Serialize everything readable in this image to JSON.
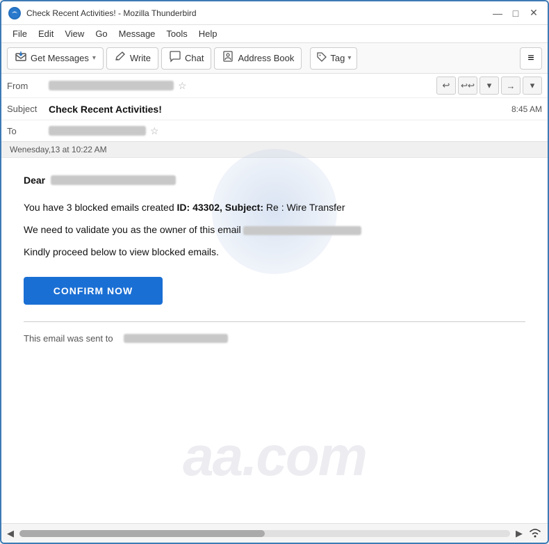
{
  "window": {
    "title": "Check Recent Activities! - Mozilla Thunderbird",
    "icon": "TB"
  },
  "title_controls": {
    "minimize": "—",
    "maximize": "□",
    "close": "✕"
  },
  "menu": {
    "items": [
      "File",
      "Edit",
      "View",
      "Go",
      "Message",
      "Tools",
      "Help"
    ]
  },
  "toolbar": {
    "get_messages_label": "Get Messages",
    "write_label": "Write",
    "chat_label": "Chat",
    "address_book_label": "Address Book",
    "tag_label": "Tag",
    "hamburger_icon": "≡"
  },
  "email_header": {
    "from_label": "From",
    "to_label": "To",
    "subject_label": "Subject",
    "subject_text": "Check Recent Activities!",
    "time": "8:45 AM",
    "star_char": "☆"
  },
  "email_body": {
    "date_strip": "Wenesday,13 at 10:22 AM",
    "dear_word": "Dear",
    "body_line1_pre": "You have 3 blocked emails created  ",
    "body_line1_bold": "ID: 43302,  Subject:",
    "body_line1_post": " Re : Wire Transfer",
    "body_line2_pre": "We need to validate you as the owner of this email",
    "body_line3": "Kindly proceed below to view blocked emails.",
    "confirm_btn_label": "CONFIRM NOW",
    "footer_pre": "This email was sent to"
  },
  "nav_buttons": {
    "back": "↩",
    "reply_all": "↩↩",
    "dropdown1": "▾",
    "forward": "→",
    "dropdown2": "▾"
  },
  "watermark": {
    "text": "aa.com"
  }
}
